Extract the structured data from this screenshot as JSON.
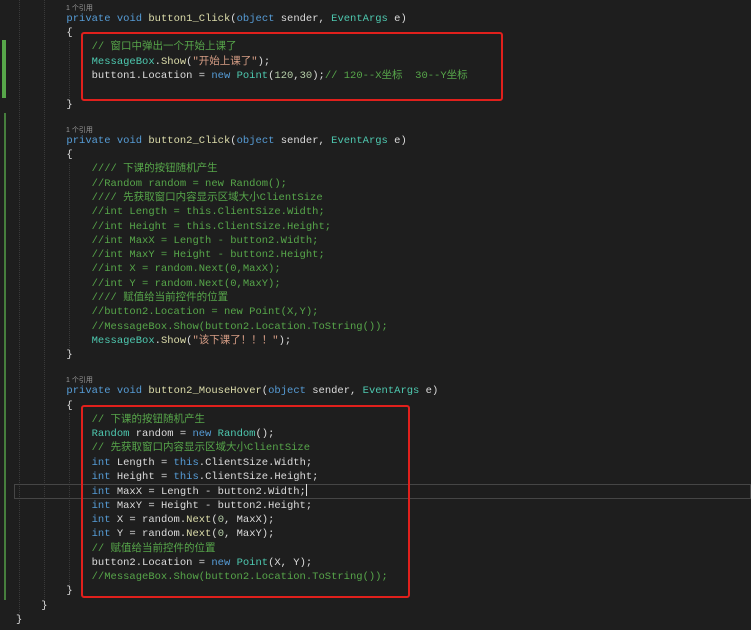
{
  "theme": {
    "background": "#1e1e1e",
    "plain": "#dcdcdc",
    "keyword": "#569cd6",
    "type": "#4ec9b0",
    "method": "#dcdcaa",
    "string": "#d69d85",
    "comment": "#57a64a",
    "number": "#b5cea8",
    "codelens": "#999999",
    "annotation": "#e0201c",
    "change_bar": "#57a64a"
  },
  "code": {
    "lines": [
      {
        "lens": "1 个引用",
        "tokens": [
          [
            "p",
            "        "
          ],
          [
            "kw",
            "private"
          ],
          [
            "p",
            " "
          ],
          [
            "kw",
            "void"
          ],
          [
            "p",
            " "
          ],
          [
            "fn",
            "button1_Click"
          ],
          [
            "p",
            "("
          ],
          [
            "kw",
            "object"
          ],
          [
            "p",
            " sender, "
          ],
          [
            "ty",
            "EventArgs"
          ],
          [
            "p",
            " e)"
          ]
        ]
      },
      {
        "tokens": [
          [
            "p",
            "        {"
          ]
        ]
      },
      {
        "tokens": [
          [
            "p",
            "            "
          ],
          [
            "cm",
            "// 窗口中弹出一个开始上课了"
          ]
        ]
      },
      {
        "tokens": [
          [
            "p",
            "            "
          ],
          [
            "ty",
            "MessageBox"
          ],
          [
            "p",
            "."
          ],
          [
            "fn",
            "Show"
          ],
          [
            "p",
            "("
          ],
          [
            "st",
            "\"开始上课了\""
          ],
          [
            "p",
            ");"
          ]
        ]
      },
      {
        "tokens": [
          [
            "p",
            "            button1.Location = "
          ],
          [
            "kw",
            "new"
          ],
          [
            "p",
            " "
          ],
          [
            "ty",
            "Point"
          ],
          [
            "p",
            "("
          ],
          [
            "nu",
            "120"
          ],
          [
            "p",
            ","
          ],
          [
            "nu",
            "30"
          ],
          [
            "p",
            ");"
          ],
          [
            "cm",
            "// 120--X坐标  30--Y坐标"
          ]
        ]
      },
      {
        "tokens": []
      },
      {
        "tokens": [
          [
            "p",
            "        }"
          ]
        ]
      },
      {
        "tokens": []
      },
      {
        "lens": "1 个引用",
        "tokens": [
          [
            "p",
            "        "
          ],
          [
            "kw",
            "private"
          ],
          [
            "p",
            " "
          ],
          [
            "kw",
            "void"
          ],
          [
            "p",
            " "
          ],
          [
            "fn",
            "button2_Click"
          ],
          [
            "p",
            "("
          ],
          [
            "kw",
            "object"
          ],
          [
            "p",
            " sender, "
          ],
          [
            "ty",
            "EventArgs"
          ],
          [
            "p",
            " e)"
          ]
        ]
      },
      {
        "tokens": [
          [
            "p",
            "        {"
          ]
        ]
      },
      {
        "tokens": [
          [
            "p",
            "            "
          ],
          [
            "cm",
            "//// 下课的按钮随机产生"
          ]
        ]
      },
      {
        "tokens": [
          [
            "p",
            "            "
          ],
          [
            "cm",
            "//Random random = new Random();"
          ]
        ]
      },
      {
        "tokens": [
          [
            "p",
            "            "
          ],
          [
            "cm",
            "//// 先获取窗口内容显示区域大小ClientSize"
          ]
        ]
      },
      {
        "tokens": [
          [
            "p",
            "            "
          ],
          [
            "cm",
            "//int Length = this.ClientSize.Width;"
          ]
        ]
      },
      {
        "tokens": [
          [
            "p",
            "            "
          ],
          [
            "cm",
            "//int Height = this.ClientSize.Height;"
          ]
        ]
      },
      {
        "tokens": [
          [
            "p",
            "            "
          ],
          [
            "cm",
            "//int MaxX = Length - button2.Width;"
          ]
        ]
      },
      {
        "tokens": [
          [
            "p",
            "            "
          ],
          [
            "cm",
            "//int MaxY = Height - button2.Height;"
          ]
        ]
      },
      {
        "tokens": [
          [
            "p",
            "            "
          ],
          [
            "cm",
            "//int X = random.Next(0,MaxX);"
          ]
        ]
      },
      {
        "tokens": [
          [
            "p",
            "            "
          ],
          [
            "cm",
            "//int Y = random.Next(0,MaxY);"
          ]
        ]
      },
      {
        "tokens": [
          [
            "p",
            "            "
          ],
          [
            "cm",
            "//// 赋值给当前控件的位置"
          ]
        ]
      },
      {
        "tokens": [
          [
            "p",
            "            "
          ],
          [
            "cm",
            "//button2.Location = new Point(X,Y);"
          ]
        ]
      },
      {
        "tokens": [
          [
            "p",
            "            "
          ],
          [
            "cm",
            "//MessageBox.Show(button2.Location.ToString());"
          ]
        ]
      },
      {
        "tokens": [
          [
            "p",
            "            "
          ],
          [
            "ty",
            "MessageBox"
          ],
          [
            "p",
            "."
          ],
          [
            "fn",
            "Show"
          ],
          [
            "p",
            "("
          ],
          [
            "st",
            "\"该下课了！！！\""
          ],
          [
            "p",
            ");"
          ]
        ]
      },
      {
        "tokens": [
          [
            "p",
            "        }"
          ]
        ]
      },
      {
        "tokens": []
      },
      {
        "lens": "1 个引用",
        "tokens": [
          [
            "p",
            "        "
          ],
          [
            "kw",
            "private"
          ],
          [
            "p",
            " "
          ],
          [
            "kw",
            "void"
          ],
          [
            "p",
            " "
          ],
          [
            "fn",
            "button2_MouseHover"
          ],
          [
            "p",
            "("
          ],
          [
            "kw",
            "object"
          ],
          [
            "p",
            " sender, "
          ],
          [
            "ty",
            "EventArgs"
          ],
          [
            "p",
            " e)"
          ]
        ]
      },
      {
        "tokens": [
          [
            "p",
            "        {"
          ]
        ]
      },
      {
        "tokens": [
          [
            "p",
            "            "
          ],
          [
            "cm",
            "// 下课的按钮随机产生"
          ]
        ]
      },
      {
        "tokens": [
          [
            "p",
            "            "
          ],
          [
            "ty",
            "Random"
          ],
          [
            "p",
            " random = "
          ],
          [
            "kw",
            "new"
          ],
          [
            "p",
            " "
          ],
          [
            "ty",
            "Random"
          ],
          [
            "p",
            "();"
          ]
        ]
      },
      {
        "tokens": [
          [
            "p",
            "            "
          ],
          [
            "cm",
            "// 先获取窗口内容显示区域大小ClientSize"
          ]
        ]
      },
      {
        "tokens": [
          [
            "p",
            "            "
          ],
          [
            "kw",
            "int"
          ],
          [
            "p",
            " Length = "
          ],
          [
            "kw",
            "this"
          ],
          [
            "p",
            ".ClientSize.Width;"
          ]
        ]
      },
      {
        "tokens": [
          [
            "p",
            "            "
          ],
          [
            "kw",
            "int"
          ],
          [
            "p",
            " Height = "
          ],
          [
            "kw",
            "this"
          ],
          [
            "p",
            ".ClientSize.Height;"
          ]
        ]
      },
      {
        "current": true,
        "tokens": [
          [
            "p",
            "            "
          ],
          [
            "kw",
            "int"
          ],
          [
            "p",
            " MaxX = Length - button2.Width;"
          ]
        ]
      },
      {
        "tokens": [
          [
            "p",
            "            "
          ],
          [
            "kw",
            "int"
          ],
          [
            "p",
            " MaxY = Height - button2.Height;"
          ]
        ]
      },
      {
        "tokens": [
          [
            "p",
            "            "
          ],
          [
            "kw",
            "int"
          ],
          [
            "p",
            " X = random."
          ],
          [
            "fn",
            "Next"
          ],
          [
            "p",
            "("
          ],
          [
            "nu",
            "0"
          ],
          [
            "p",
            ", MaxX);"
          ]
        ]
      },
      {
        "tokens": [
          [
            "p",
            "            "
          ],
          [
            "kw",
            "int"
          ],
          [
            "p",
            " Y = random."
          ],
          [
            "fn",
            "Next"
          ],
          [
            "p",
            "("
          ],
          [
            "nu",
            "0"
          ],
          [
            "p",
            ", MaxY);"
          ]
        ]
      },
      {
        "tokens": [
          [
            "p",
            "            "
          ],
          [
            "cm",
            "// 赋值给当前控件的位置"
          ]
        ]
      },
      {
        "tokens": [
          [
            "p",
            "            button2.Location = "
          ],
          [
            "kw",
            "new"
          ],
          [
            "p",
            " "
          ],
          [
            "ty",
            "Point"
          ],
          [
            "p",
            "(X, Y);"
          ]
        ]
      },
      {
        "tokens": [
          [
            "p",
            "            "
          ],
          [
            "cm",
            "//MessageBox.Show(button2.Location.ToString());"
          ]
        ]
      },
      {
        "tokens": [
          [
            "p",
            "        }"
          ]
        ]
      },
      {
        "tokens": [
          [
            "p",
            "    }"
          ]
        ]
      },
      {
        "tokens": [
          [
            "p",
            "}"
          ]
        ]
      }
    ]
  }
}
